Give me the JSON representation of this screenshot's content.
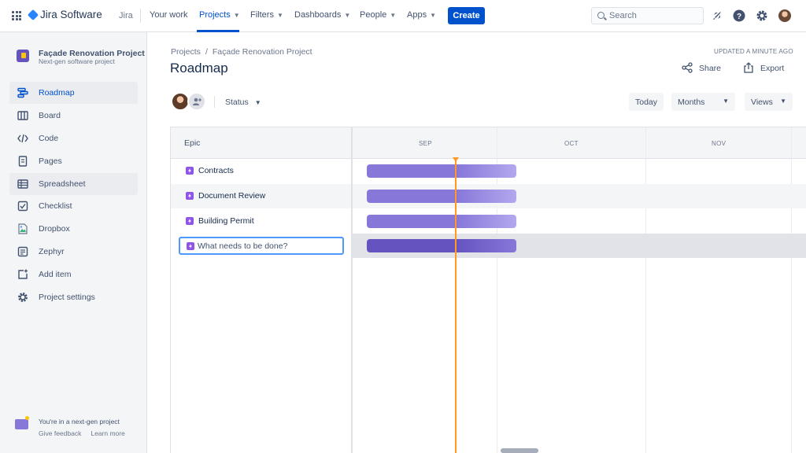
{
  "app": {
    "product_name": "Jira Software",
    "product_sub": "Jira"
  },
  "nav": {
    "items": [
      {
        "label": "Your work",
        "dropdown": false
      },
      {
        "label": "Projects",
        "dropdown": true,
        "active": true
      },
      {
        "label": "Filters",
        "dropdown": true
      },
      {
        "label": "Dashboards",
        "dropdown": true
      },
      {
        "label": "People",
        "dropdown": true
      },
      {
        "label": "Apps",
        "dropdown": true
      }
    ],
    "create_label": "Create",
    "search_placeholder": "Search",
    "accent": "#0052cc"
  },
  "sidebar": {
    "project_name": "Façade Renovation Project",
    "project_type": "Next-gen software project",
    "items": [
      {
        "label": "Roadmap",
        "icon": "roadmap-icon",
        "active": true
      },
      {
        "label": "Board",
        "icon": "board-icon"
      },
      {
        "label": "Code",
        "icon": "code-icon"
      },
      {
        "label": "Pages",
        "icon": "pages-icon"
      },
      {
        "label": "Spreadsheet",
        "icon": "spreadsheet-icon",
        "hover": true
      },
      {
        "label": "Checklist",
        "icon": "checklist-icon"
      },
      {
        "label": "Dropbox",
        "icon": "dropbox-icon"
      },
      {
        "label": "Zephyr",
        "icon": "zephyr-icon"
      },
      {
        "label": "Add item",
        "icon": "add-item-icon"
      },
      {
        "label": "Project settings",
        "icon": "gear-icon"
      }
    ],
    "footer_text": "You're in a next-gen project",
    "footer_feedback": "Give feedback",
    "footer_learn": "Learn more"
  },
  "main": {
    "breadcrumb": [
      "Projects",
      "Façade Renovation Project"
    ],
    "breadcrumb_sep": "/",
    "title": "Roadmap",
    "updated": "UPDATED A MINUTE AGO",
    "share_label": "Share",
    "export_label": "Export",
    "status_label": "Status",
    "today_label": "Today",
    "months_label": "Months",
    "views_label": "Views"
  },
  "roadmap": {
    "epic_header": "Epic",
    "months": [
      "SEP",
      "OCT",
      "NOV"
    ],
    "epics": [
      {
        "label": "Contracts"
      },
      {
        "label": "Document Review"
      },
      {
        "label": "Building Permit"
      }
    ],
    "new_epic_placeholder": "What needs to be done?",
    "bar_color": "#8777d9",
    "today_color": "#ff991f"
  }
}
